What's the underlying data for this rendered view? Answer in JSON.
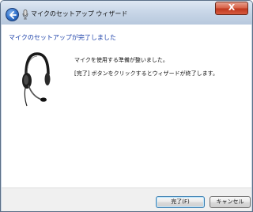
{
  "window": {
    "title": "マイクのセットアップ ウィザード",
    "close_label": "X"
  },
  "content": {
    "heading": "マイクのセットアップが完了しました",
    "message_ready": "マイクを使用する準備が整いました。",
    "message_finish": "[完了] ボタンをクリックするとウィザードが終了します。"
  },
  "buttons": {
    "finish_label": "完了(F)",
    "cancel_label": "キャンセル"
  },
  "icons": {
    "back": "back-arrow-icon",
    "title_mic": "microphone-icon",
    "headset": "headset-icon"
  },
  "colors": {
    "heading": "#1a3fa8",
    "close_button": "#c0391f",
    "back_button": "#2f6fc8"
  }
}
